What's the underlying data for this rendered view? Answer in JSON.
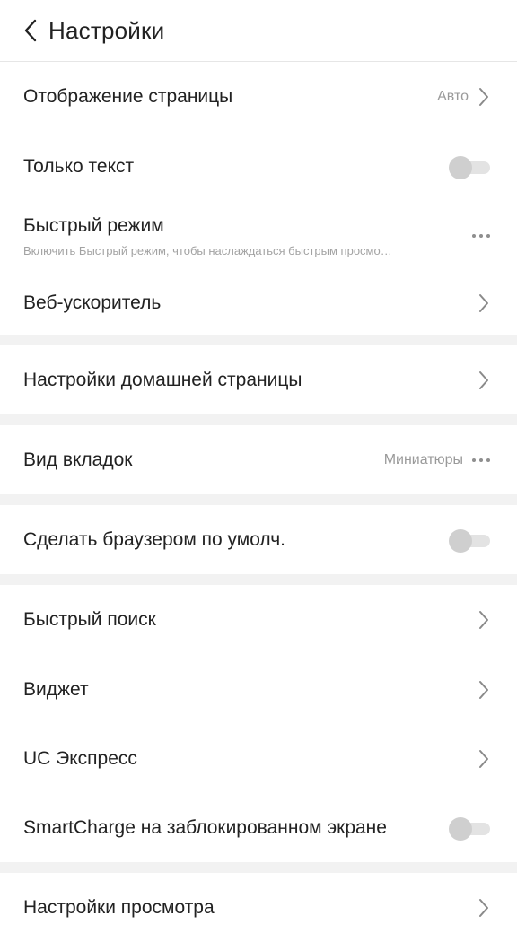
{
  "header": {
    "title": "Настройки"
  },
  "items": {
    "page_display": {
      "label": "Отображение страницы",
      "value": "Авто"
    },
    "text_only": {
      "label": "Только текст"
    },
    "fast_mode": {
      "label": "Быстрый режим",
      "subtitle": "Включить Быстрый режим, чтобы наслаждаться быстрым просмо…"
    },
    "web_accelerator": {
      "label": "Веб-ускоритель"
    },
    "homepage_settings": {
      "label": "Настройки домашней страницы"
    },
    "tab_view": {
      "label": "Вид вкладок",
      "value": "Миниатюры"
    },
    "default_browser": {
      "label": "Сделать браузером по умолч."
    },
    "quick_search": {
      "label": "Быстрый поиск"
    },
    "widget": {
      "label": "Виджет"
    },
    "uc_express": {
      "label": "UC Экспресс"
    },
    "smartcharge": {
      "label": "SmartCharge на заблокированном экране"
    },
    "browse_settings": {
      "label": "Настройки просмотра"
    }
  }
}
